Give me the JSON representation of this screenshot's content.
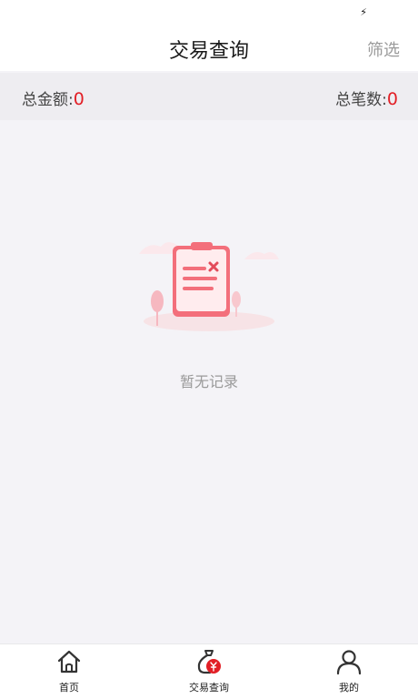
{
  "status_bar": {
    "charging_glyph": "⚡"
  },
  "header": {
    "title": "交易查询",
    "filter_label": "筛选"
  },
  "summary": {
    "total_amount_label": "总金额:",
    "total_amount_value": "0",
    "total_count_label": "总笔数:",
    "total_count_value": "0"
  },
  "empty_state": {
    "icon": "empty-clipboard-icon",
    "message": "暂无记录"
  },
  "tabbar": {
    "items": [
      {
        "label": "首页",
        "icon": "home-icon",
        "active": false
      },
      {
        "label": "交易查询",
        "icon": "money-bag-icon",
        "active": true
      },
      {
        "label": "我的",
        "icon": "user-icon",
        "active": false
      }
    ]
  },
  "colors": {
    "accent": "#e21f26",
    "background": "#f4f3f7"
  }
}
